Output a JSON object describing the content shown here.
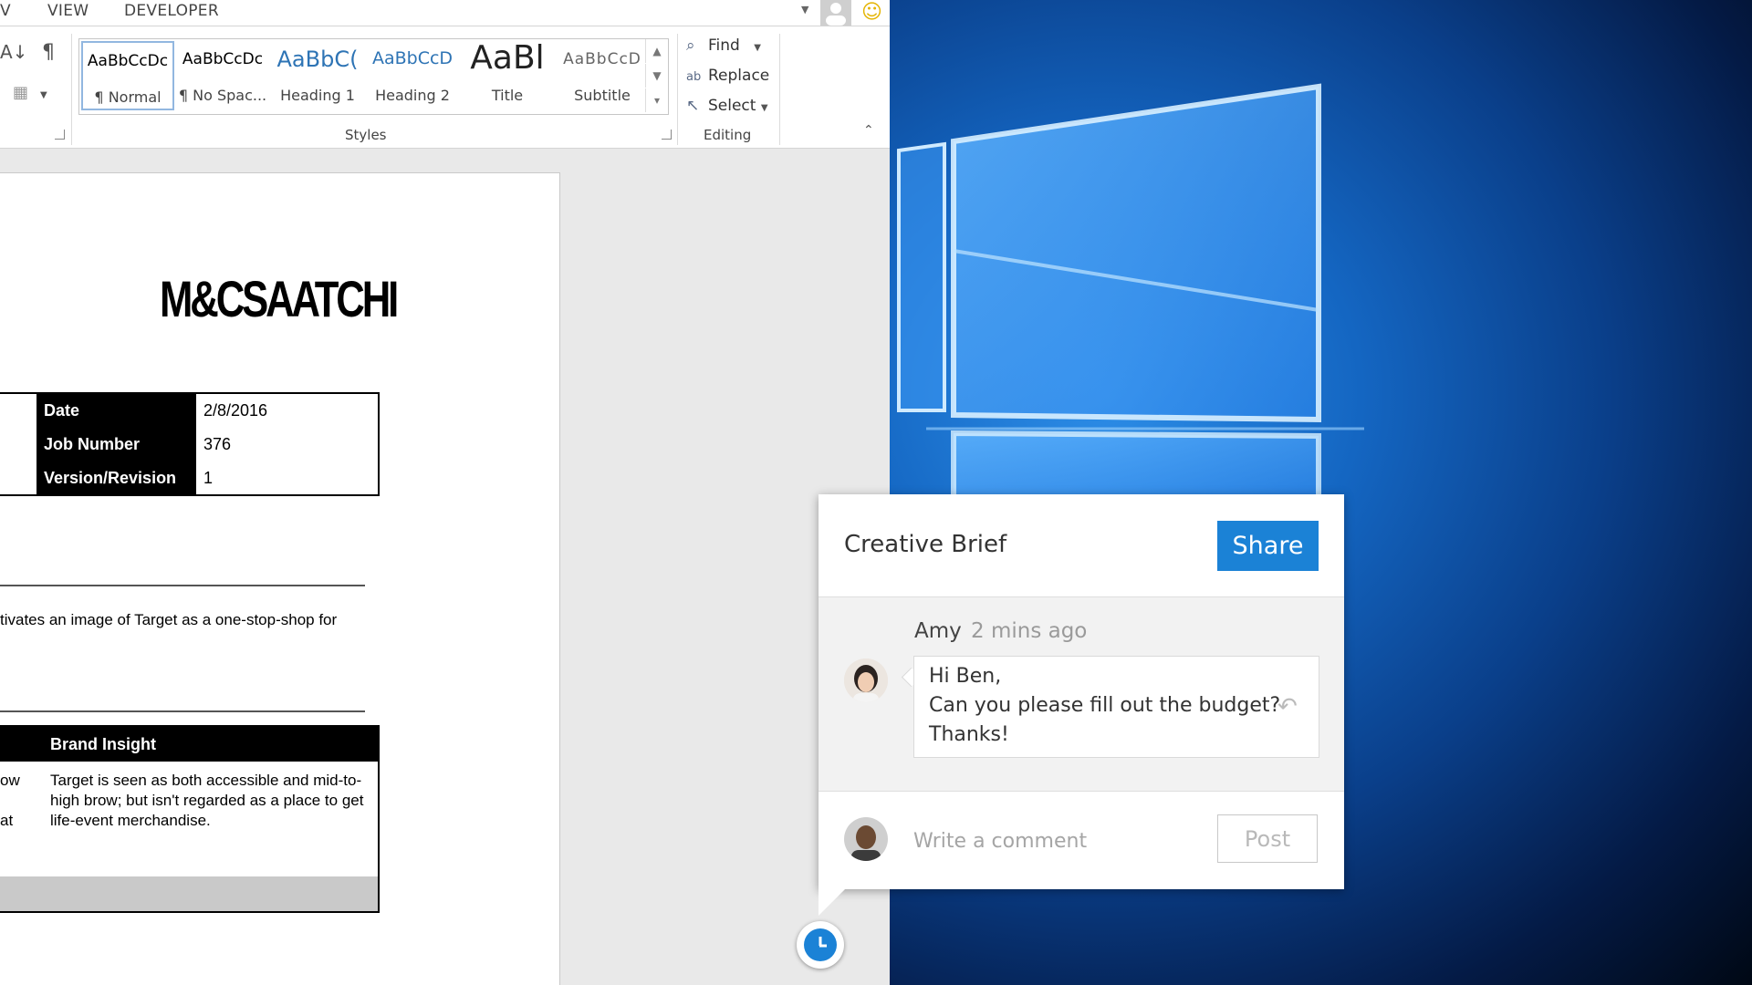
{
  "ribbon": {
    "tabs": [
      "V",
      "VIEW",
      "DEVELOPER"
    ],
    "styles": [
      {
        "preview": "AaBbCcDc",
        "name": "¶ Normal"
      },
      {
        "preview": "AaBbCcDc",
        "name": "¶ No Spac..."
      },
      {
        "preview": "AaBbC(",
        "name": "Heading 1"
      },
      {
        "preview": "AaBbCcD",
        "name": "Heading 2"
      },
      {
        "preview": "AaBl",
        "name": "Title"
      },
      {
        "preview": "AaBbCcD",
        "name": "Subtitle"
      }
    ],
    "styles_group_label": "Styles",
    "editing": {
      "find": "Find",
      "replace": "Replace",
      "select": "Select"
    },
    "editing_group_label": "Editing"
  },
  "document": {
    "logo": "M&CSAATCHI",
    "info_table": [
      {
        "label": "Date",
        "value": "2/8/2016"
      },
      {
        "label": "Job Number",
        "value": "376"
      },
      {
        "label": "Version/Revision",
        "value": "1"
      }
    ],
    "body_text": "tivates an image of Target as a one-stop-shop for",
    "brand_table": {
      "header": "Brand Insight",
      "left_fragments": [
        "ow",
        "",
        "at"
      ],
      "text": "Target is seen as both accessible and mid-to-high brow; but isn't regarded as a place to get life-event merchandise."
    }
  },
  "comment_panel": {
    "title": "Creative Brief",
    "share_label": "Share",
    "comment": {
      "author": "Amy",
      "time": "2 mins ago",
      "lines": [
        "Hi Ben,",
        "Can you please fill out the budget?",
        "Thanks!"
      ]
    },
    "input_placeholder": "Write a comment",
    "post_label": "Post"
  },
  "colors": {
    "accent": "#1b82d6",
    "desktop_blue": "#1466c2"
  }
}
